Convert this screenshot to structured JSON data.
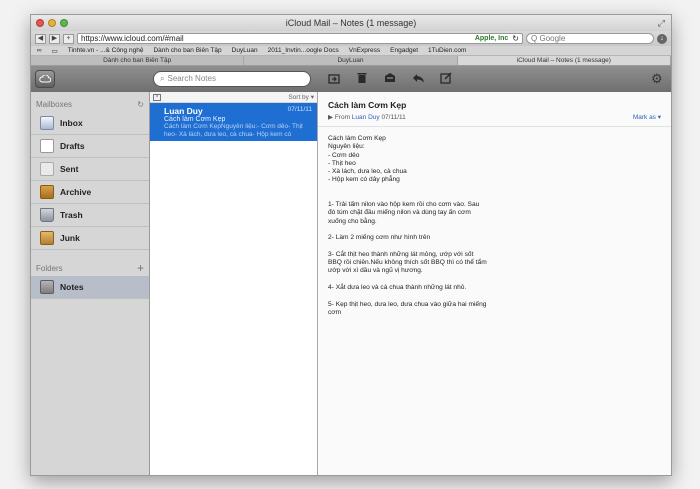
{
  "browser": {
    "window_title": "iCloud Mail – Notes (1 message)",
    "url": "https://www.icloud.com/#mail",
    "site_identity": "Apple, Inc",
    "search_placeholder": "Google",
    "bookmarks": [
      "Tinhte.vn - ...& Công nghệ",
      "Dành cho ban Biên Tập",
      "DuyLuan",
      "2011_Invtin...oogle Docs",
      "VnExpress",
      "Engadget",
      "1TuDien.com"
    ],
    "tabs": [
      "Dành cho ban Biên Tập",
      "DuyLuan",
      "iCloud Mail – Notes (1 message)"
    ]
  },
  "toolbar": {
    "search_placeholder": "Search Notes",
    "icons": [
      "cloud-icon",
      "move-icon",
      "trash-icon",
      "flag-icon",
      "reply-icon",
      "compose-icon",
      "gear-icon"
    ]
  },
  "sidebar": {
    "mailboxes_label": "Mailboxes",
    "folders_label": "Folders",
    "items": [
      {
        "label": "Inbox",
        "icon": "inbox-icon"
      },
      {
        "label": "Drafts",
        "icon": "drafts-icon"
      },
      {
        "label": "Sent",
        "icon": "sent-icon"
      },
      {
        "label": "Archive",
        "icon": "archive-icon"
      },
      {
        "label": "Trash",
        "icon": "trash-icon"
      },
      {
        "label": "Junk",
        "icon": "junk-icon"
      }
    ],
    "folders": [
      {
        "label": "Notes",
        "icon": "notes-folder-icon"
      }
    ]
  },
  "message_list": {
    "sort_label": "Sort by ▾",
    "messages": [
      {
        "from": "Luan Duy",
        "date": "07/11/11",
        "subject": "Cách làm Cơm Kẹp",
        "preview": "Cách làm Cơm KẹpNguyên liệu:- Cơm dẻo- Thịt heo- Xà lách, dưa leo, cà chua- Hộp kem có"
      }
    ]
  },
  "reader": {
    "subject": "Cách làm Cơm Kẹp",
    "from_prefix": "From",
    "from": "Luan Duy",
    "date": "07/11/11",
    "mark_as": "Mark as ▾",
    "body": {
      "title": "Cách làm Cơm Kẹp",
      "ingredients_label": "Nguyên liệu:",
      "ingredients": [
        "- Cơm dẻo",
        "- Thịt heo",
        "- Xà lách, dưa leo, cà chua",
        "- Hộp kem có dây phẳng"
      ],
      "steps": [
        "1- Trải tấm nilon vào hộp kem rồi cho cơm vào. Sau đó túm chặt đầu miếng nilon và dùng tay ấn cơm xuống cho bằng.",
        "2- Làm 2 miếng cơm như hình trên",
        "3- Cắt thịt heo thành những lát mỏng, ướp với sốt BBQ rồi chiên.Nếu không thích sốt BBQ thì có thể tẩm ướp với xì dầu và ngũ vị hương.",
        "4- Xắt dưa leo và cà chua thành những lát nhỏ.",
        "5- Kẹp thịt heo, dưa leo, dưa chua vào giữa hai miếng cơm"
      ]
    }
  }
}
